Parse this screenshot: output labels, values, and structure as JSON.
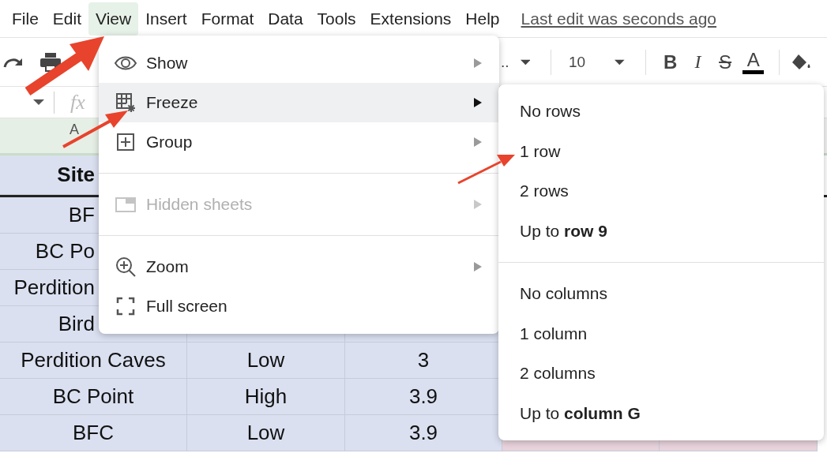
{
  "menubar": {
    "items": [
      {
        "label": "File",
        "selected": false
      },
      {
        "label": "Edit",
        "selected": false
      },
      {
        "label": "View",
        "selected": true
      },
      {
        "label": "Insert",
        "selected": false
      },
      {
        "label": "Format",
        "selected": false
      },
      {
        "label": "Data",
        "selected": false
      },
      {
        "label": "Tools",
        "selected": false
      },
      {
        "label": "Extensions",
        "selected": false
      },
      {
        "label": "Help",
        "selected": false
      }
    ],
    "last_edit": "Last edit was seconds ago"
  },
  "toolbar": {
    "font_name": "..",
    "font_size": "10",
    "format_buttons": [
      {
        "label": "B",
        "kind": "bold"
      },
      {
        "label": "I",
        "kind": "italic"
      },
      {
        "label": "S",
        "kind": "strike"
      },
      {
        "label": "A",
        "kind": "text_color"
      }
    ]
  },
  "formula_bar": {
    "fx": "fx"
  },
  "column_headers": [
    "A"
  ],
  "sheet": {
    "rows": [
      {
        "kind": "header",
        "cells": [
          "Site",
          null,
          null,
          null,
          null
        ]
      },
      {
        "kind": "data",
        "cells": [
          "BF",
          null,
          null,
          null,
          null
        ]
      },
      {
        "kind": "data",
        "cells": [
          "BC Po",
          null,
          null,
          null,
          null
        ]
      },
      {
        "kind": "data",
        "cells": [
          "Perdition",
          null,
          null,
          null,
          null
        ]
      },
      {
        "kind": "data",
        "cells": [
          "Bird",
          null,
          null,
          null,
          null
        ]
      },
      {
        "kind": "data",
        "cells": [
          "Perdition Caves",
          "Low",
          "3",
          null,
          null
        ]
      },
      {
        "kind": "data",
        "cells": [
          "BC Point",
          "High",
          "3.9",
          null,
          null
        ]
      },
      {
        "kind": "data",
        "cells": [
          "BFC",
          "Low",
          "3.9",
          null,
          null
        ]
      }
    ]
  },
  "view_menu": {
    "sections": [
      [
        {
          "label": "Show",
          "submenu": true,
          "selected": false,
          "disabled": false
        },
        {
          "label": "Freeze",
          "submenu": true,
          "selected": true,
          "disabled": false
        },
        {
          "label": "Group",
          "submenu": true,
          "selected": false,
          "disabled": false
        }
      ],
      [
        {
          "label": "Hidden sheets",
          "submenu": true,
          "selected": false,
          "disabled": true
        }
      ],
      [
        {
          "label": "Zoom",
          "submenu": true,
          "selected": false,
          "disabled": false
        },
        {
          "label": "Full screen",
          "submenu": false,
          "selected": false,
          "disabled": false
        }
      ]
    ]
  },
  "freeze_submenu": {
    "sections": [
      [
        "No rows",
        "1 row",
        "2 rows",
        "Up to **row 9**"
      ],
      [
        "No columns",
        "1 column",
        "2 columns",
        "Up to **column G**"
      ]
    ]
  }
}
